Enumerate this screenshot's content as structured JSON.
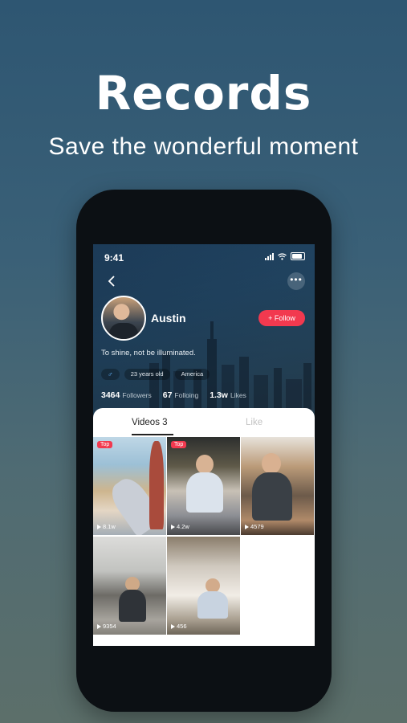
{
  "headline": "Records",
  "subline": "Save the wonderful moment",
  "status_bar": {
    "time": "9:41"
  },
  "profile": {
    "name": "Austin",
    "follow_label": "+ Follow",
    "bio": "To shine, not be illuminated.",
    "tags": {
      "gender": "♂",
      "age": "23 years old",
      "location": "America"
    },
    "stats": {
      "followers_count": "3464",
      "followers_label": "Followers",
      "following_count": "67",
      "following_label": "Folloing",
      "likes_count": "1.3w",
      "likes_label": "Likes"
    }
  },
  "tabs": {
    "videos": "Videos 3",
    "like": "Like"
  },
  "videos": [
    {
      "badge": "Top",
      "count": "8.1w"
    },
    {
      "badge": "Top",
      "count": "4.2w"
    },
    {
      "badge": "",
      "count": "4579"
    },
    {
      "badge": "",
      "count": "9354"
    },
    {
      "badge": "",
      "count": "456"
    }
  ],
  "colors": {
    "accent": "#f2394f",
    "gender": "#63b5ff"
  }
}
